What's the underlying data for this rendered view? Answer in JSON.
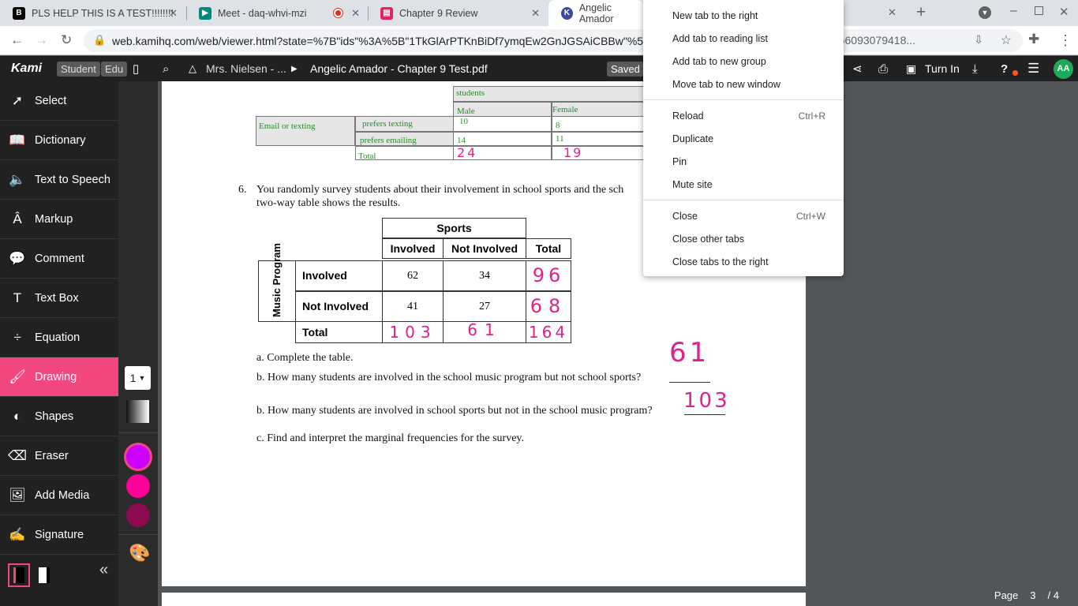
{
  "tabs": [
    {
      "title": "PLS HELP THIS IS A TEST!!!!!!!!",
      "favicon": "brainly-icon",
      "color": "#000000"
    },
    {
      "title": "Meet - daq-whvi-mzi",
      "favicon": "meet-icon",
      "color": "#00897b"
    },
    {
      "title": "Chapter 9 Review",
      "favicon": "classroom-icon",
      "color": "#e91e63"
    },
    {
      "title": "Angelic Amador",
      "favicon": "kami-icon",
      "color": "#3c4aa6"
    }
  ],
  "address": {
    "url": "web.kamihq.com/web/viewer.html?state=%7B\"ids\"%3A%5B\"1TkGlArPTKnBiDf7ymqEw2GnJGSAiCBBw\"%5D",
    "url_tail": "085190660930794​18..."
  },
  "kami": {
    "logo": "Kami",
    "role_badge": "Student",
    "edu_badge": "Edu",
    "breadcrumb_folder": "Mrs. Nielsen - ...",
    "document_title": "Angelic Amador - Chapter 9 Test.pdf",
    "saved": "Saved",
    "turn_in": "Turn In",
    "avatar": "AA",
    "page_label": "Page",
    "page_current": "3",
    "page_total": "/ 4"
  },
  "sidebar": [
    {
      "label": "Select",
      "icon": "cursor-icon"
    },
    {
      "label": "Dictionary",
      "icon": "book-icon"
    },
    {
      "label": "Text to Speech",
      "icon": "speaker-icon"
    },
    {
      "label": "Markup",
      "icon": "highlighter-icon"
    },
    {
      "label": "Comment",
      "icon": "comment-icon"
    },
    {
      "label": "Text Box",
      "icon": "text-icon"
    },
    {
      "label": "Equation",
      "icon": "divide-icon"
    },
    {
      "label": "Drawing",
      "icon": "brush-icon"
    },
    {
      "label": "Shapes",
      "icon": "shapes-icon"
    },
    {
      "label": "Eraser",
      "icon": "eraser-icon"
    },
    {
      "label": "Add Media",
      "icon": "image-icon"
    },
    {
      "label": "Signature",
      "icon": "signature-icon"
    }
  ],
  "drawing": {
    "size": "1",
    "colors": [
      "#cc00ff",
      "#ff0099",
      "#8b0a50"
    ]
  },
  "doc": {
    "top_table": {
      "header": "students",
      "col_male": "Male",
      "col_female": "Female",
      "row_group": "Email or texting",
      "row1": "prefers texting",
      "row2": "prefers emailing",
      "row3": "Total",
      "m1": "10",
      "f1": "8",
      "m2": "14",
      "f2": "11",
      "m3": "24",
      "f3": "19"
    },
    "q6_num": "6.",
    "q6_text": "You randomly survey students about their involvement in school sports and the sch",
    "q6_text2": "two-way table shows the results.",
    "sports": {
      "header": "Sports",
      "col1": "Involved",
      "col2": "Not Involved",
      "col3": "Total",
      "side": "Music Program",
      "row1": "Involved",
      "row2": "Not Involved",
      "row3": "Total",
      "r1": [
        "62",
        "34",
        "96"
      ],
      "r2": [
        "41",
        "27",
        "68"
      ],
      "r3": [
        "103",
        "61",
        "164"
      ]
    },
    "qa": "a.   Complete the table.",
    "qb1": "b.  How many students are involved in the school music program but not school sports?",
    "ans_b1": "61",
    "qb2": "b.   How many students are involved in school sports but not in the school music program?",
    "ans_b2": "103",
    "qc": "c.   Find and interpret the marginal frequencies for the survey."
  },
  "context_menu": [
    {
      "label": "New tab to the right",
      "shortcut": ""
    },
    {
      "label": "Add tab to reading list",
      "shortcut": ""
    },
    {
      "label": "Add tab to new group",
      "shortcut": ""
    },
    {
      "label": "Move tab to new window",
      "shortcut": ""
    },
    {
      "label": "Reload",
      "shortcut": "Ctrl+R"
    },
    {
      "label": "Duplicate",
      "shortcut": ""
    },
    {
      "label": "Pin",
      "shortcut": ""
    },
    {
      "label": "Mute site",
      "shortcut": ""
    },
    {
      "label": "Close",
      "shortcut": "Ctrl+W"
    },
    {
      "label": "Close other tabs",
      "shortcut": ""
    },
    {
      "label": "Close tabs to the right",
      "shortcut": ""
    }
  ]
}
